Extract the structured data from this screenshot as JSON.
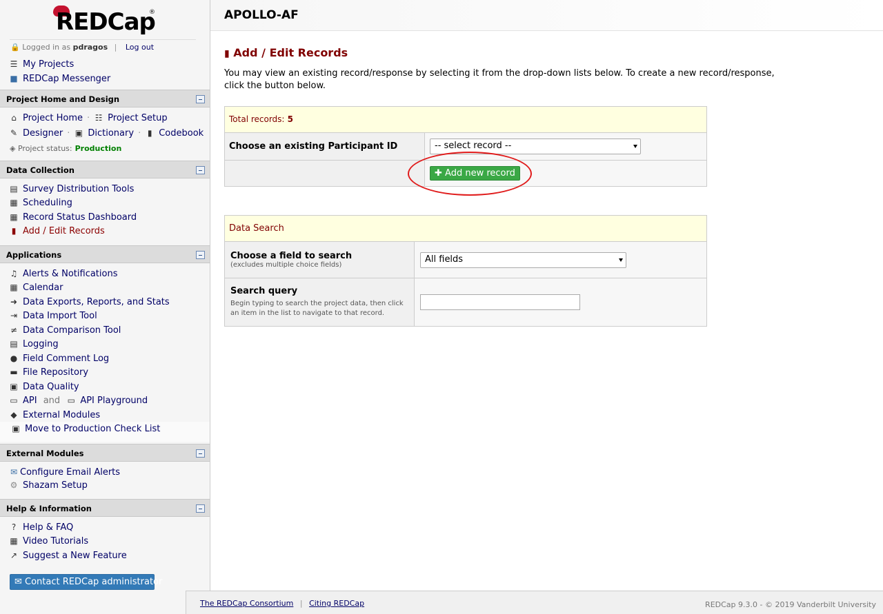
{
  "app": {
    "logo_text": "REDCap",
    "logo_reg": "®",
    "project_title": "APOLLO-AF"
  },
  "user": {
    "logged_in_prefix": "Logged in as",
    "username": "pdragos",
    "logout": "Log out"
  },
  "top_links": {
    "my_projects": "My Projects",
    "messenger": "REDCap Messenger"
  },
  "sections": {
    "project_home": "Project Home and Design",
    "data_collection": "Data Collection",
    "applications": "Applications",
    "external_modules": "External Modules",
    "help": "Help & Information"
  },
  "project_home": {
    "home": "Project Home",
    "setup": "Project Setup",
    "designer": "Designer",
    "dictionary": "Dictionary",
    "codebook": "Codebook",
    "status_label": "Project status:",
    "status_value": "Production"
  },
  "data_collection": {
    "survey_tools": "Survey Distribution Tools",
    "scheduling": "Scheduling",
    "record_status": "Record Status Dashboard",
    "add_edit": "Add / Edit Records"
  },
  "applications": {
    "alerts": "Alerts & Notifications",
    "calendar": "Calendar",
    "exports": "Data Exports, Reports, and Stats",
    "import": "Data Import Tool",
    "comparison": "Data Comparison Tool",
    "logging": "Logging",
    "comment_log": "Field Comment Log",
    "file_repo": "File Repository",
    "quality": "Data Quality",
    "api": "API",
    "and": "and",
    "api_playground": "API Playground",
    "ext_modules": "External Modules",
    "move_prod": "Move to Production Check List"
  },
  "external_modules": {
    "email_alerts": "Configure Email Alerts",
    "shazam": "Shazam Setup"
  },
  "help": {
    "faq": "Help & FAQ",
    "videos": "Video Tutorials",
    "suggest": "Suggest a New Feature",
    "contact": "Contact REDCap administrator"
  },
  "main": {
    "page_title": "Add / Edit Records",
    "intro": "You may view an existing record/response by selecting it from the drop-down lists below. To create a new record/response, click the button below.",
    "total_records_label": "Total records:",
    "total_records_value": "5",
    "choose_existing": "Choose an existing Participant ID",
    "select_record": "-- select record --",
    "add_new_record": "Add new record",
    "data_search": "Data Search",
    "choose_field": "Choose a field to search",
    "choose_field_note": "(excludes multiple choice fields)",
    "all_fields": "All fields",
    "search_query": "Search query",
    "search_query_note": "Begin typing to search the project data, then click an item in the list to navigate to that record.",
    "search_value": ""
  },
  "footer": {
    "consortium": "The REDCap Consortium",
    "citing": "Citing REDCap",
    "copyright": "REDCap 9.3.0 - © 2019 Vanderbilt University"
  }
}
